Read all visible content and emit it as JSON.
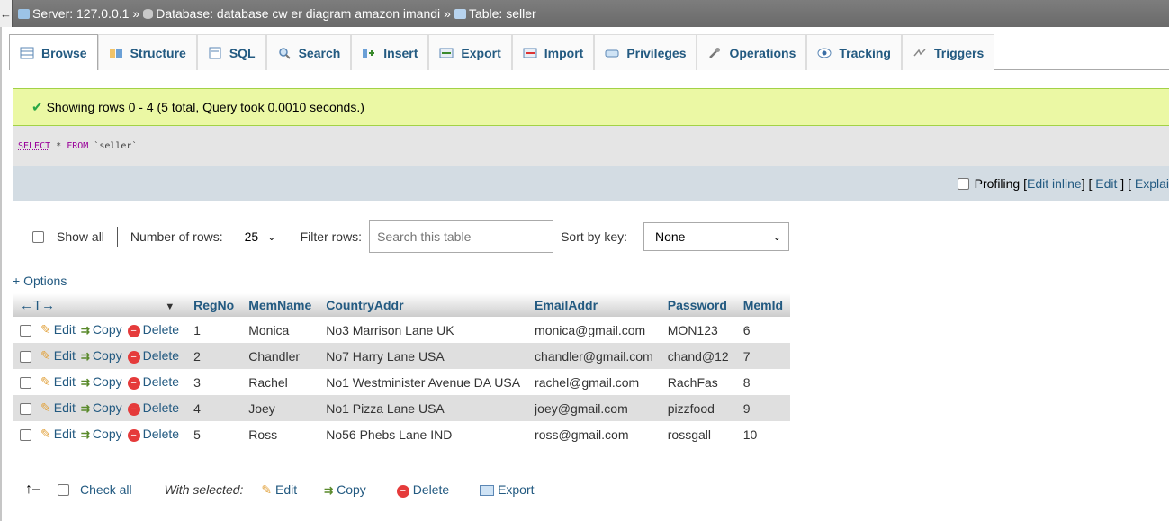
{
  "breadcrumb": {
    "back": "←",
    "server": "Server: 127.0.0.1",
    "database": "Database: database cw er diagram amazon imandi",
    "table": "Table: seller",
    "separator": "»"
  },
  "tabs": [
    {
      "label": "Browse",
      "icon": "browse-icon"
    },
    {
      "label": "Structure",
      "icon": "structure-icon"
    },
    {
      "label": "SQL",
      "icon": "sql-icon"
    },
    {
      "label": "Search",
      "icon": "search-icon"
    },
    {
      "label": "Insert",
      "icon": "insert-icon"
    },
    {
      "label": "Export",
      "icon": "export-icon"
    },
    {
      "label": "Import",
      "icon": "import-icon"
    },
    {
      "label": "Privileges",
      "icon": "privileges-icon"
    },
    {
      "label": "Operations",
      "icon": "operations-icon"
    },
    {
      "label": "Tracking",
      "icon": "tracking-icon"
    },
    {
      "label": "Triggers",
      "icon": "triggers-icon"
    }
  ],
  "message": {
    "text": "Showing rows 0 - 4 (5 total, Query took 0.0010 seconds.)"
  },
  "sql": {
    "select": "SELECT",
    "rest1": " * ",
    "from": "FROM",
    "table": " `seller`"
  },
  "profiling": {
    "label": "Profiling",
    "edit_inline": "Edit inline",
    "edit": "Edit",
    "explain": "Explai"
  },
  "nav": {
    "show_all": "Show all",
    "number_of_rows_label": "Number of rows:",
    "number_of_rows_value": "25",
    "filter_label": "Filter rows:",
    "filter_placeholder": "Search this table",
    "sort_label": "Sort by key:",
    "sort_value": "None"
  },
  "options_link": "+ Options",
  "table": {
    "arrows": "←T→",
    "columns": [
      "RegNo",
      "MemName",
      "CountryAddr",
      "EmailAddr",
      "Password",
      "MemId"
    ],
    "action_labels": {
      "edit": "Edit",
      "copy": "Copy",
      "delete": "Delete"
    },
    "rows": [
      [
        "1",
        "Monica",
        "No3 Marrison Lane UK",
        "monica@gmail.com",
        "MON123",
        "6"
      ],
      [
        "2",
        "Chandler",
        "No7 Harry Lane USA",
        "chandler@gmail.com",
        "chand@12",
        "7"
      ],
      [
        "3",
        "Rachel",
        "No1 Westminister Avenue DA USA",
        "rachel@gmail.com",
        "RachFas",
        "8"
      ],
      [
        "4",
        "Joey",
        "No1 Pizza Lane USA",
        "joey@gmail.com",
        "pizzfood",
        "9"
      ],
      [
        "5",
        "Ross",
        "No56 Phebs Lane IND",
        "ross@gmail.com",
        "rossgall",
        "10"
      ]
    ]
  },
  "bottom": {
    "check_all": "Check all",
    "with_selected": "With selected:",
    "edit": "Edit",
    "copy": "Copy",
    "delete": "Delete",
    "export": "Export"
  }
}
